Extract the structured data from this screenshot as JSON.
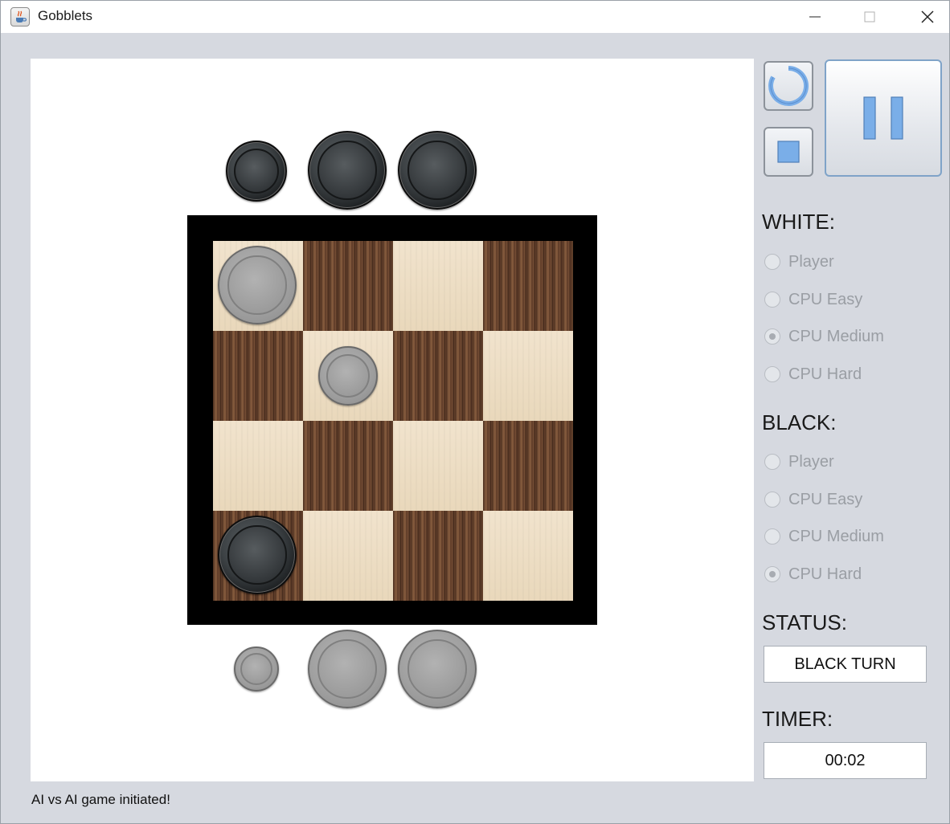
{
  "window": {
    "title": "Gobblets",
    "buttons": {
      "minimize": "minimize-icon",
      "maximize": "maximize-icon",
      "close": "close-icon"
    }
  },
  "board": {
    "rows": 4,
    "cols": 4,
    "cells_top_row_first": [
      [
        "light",
        "dark",
        "light",
        "dark"
      ],
      [
        "dark",
        "light",
        "dark",
        "light"
      ],
      [
        "light",
        "dark",
        "light",
        "dark"
      ],
      [
        "dark",
        "light",
        "dark",
        "light"
      ]
    ],
    "pieces_on_board": [
      {
        "color": "white",
        "size": "large",
        "row": 0,
        "col": 0
      },
      {
        "color": "white",
        "size": "medium",
        "row": 1,
        "col": 1
      },
      {
        "color": "black",
        "size": "large",
        "row": 3,
        "col": 0
      }
    ]
  },
  "reserves": {
    "black_top": [
      {
        "color": "black",
        "size": "small"
      },
      {
        "color": "black",
        "size": "large"
      },
      {
        "color": "black",
        "size": "large"
      }
    ],
    "white_bottom": [
      {
        "color": "white",
        "size": "tiny"
      },
      {
        "color": "white",
        "size": "large"
      },
      {
        "color": "white",
        "size": "large"
      }
    ]
  },
  "controls": {
    "restart_icon": "restart-icon",
    "stop_icon": "stop-icon",
    "pause_icon": "pause-icon",
    "accent_color": "#7aaee8"
  },
  "white": {
    "label": "WHITE:",
    "options": [
      "Player",
      "CPU Easy",
      "CPU Medium",
      "CPU Hard"
    ],
    "selected": "CPU Medium"
  },
  "black": {
    "label": "BLACK:",
    "options": [
      "Player",
      "CPU Easy",
      "CPU Medium",
      "CPU Hard"
    ],
    "selected": "CPU Hard"
  },
  "status": {
    "label": "STATUS:",
    "value": "BLACK TURN"
  },
  "timer": {
    "label": "TIMER:",
    "value": "00:02"
  },
  "footer": {
    "message": "AI vs AI game initiated!"
  }
}
